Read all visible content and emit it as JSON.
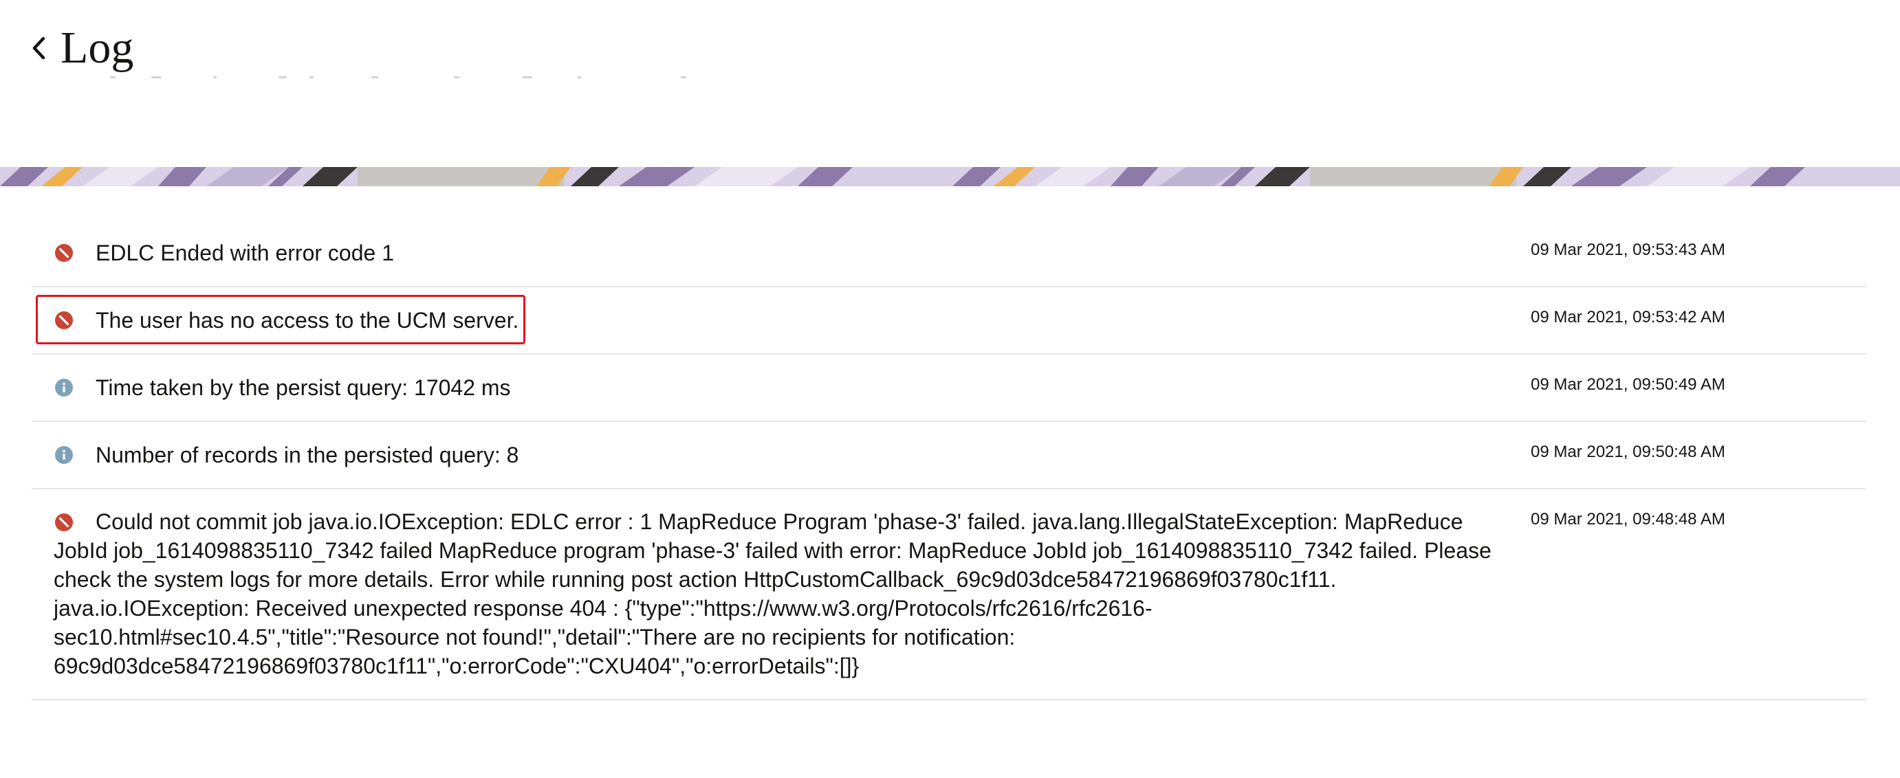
{
  "header": {
    "title": "Log",
    "back_icon": "chevron-left-icon"
  },
  "colors": {
    "error": "#c74634",
    "info": "#7ea3b8",
    "highlight": "#e0141e",
    "divider": "#e8e6e3"
  },
  "logs": [
    {
      "level": "error",
      "icon": "error-icon",
      "message": "EDLC Ended with error code 1",
      "time": "09 Mar 2021, 09:53:43 AM"
    },
    {
      "level": "error",
      "icon": "error-icon",
      "message": "The user has no access to the UCM server.",
      "time": "09 Mar 2021, 09:53:42 AM"
    },
    {
      "level": "info",
      "icon": "info-icon",
      "message": "Time taken by the persist query: 17042 ms",
      "time": "09 Mar 2021, 09:50:49 AM"
    },
    {
      "level": "info",
      "icon": "info-icon",
      "message": "Number of records in the persisted query: 8",
      "time": "09 Mar 2021, 09:50:48 AM"
    },
    {
      "level": "error",
      "icon": "error-icon",
      "message": "Could not commit job java.io.IOException: EDLC error : 1 MapReduce Program 'phase-3' failed. java.lang.IllegalStateException: MapReduce JobId job_1614098835110_7342 failed MapReduce program 'phase-3' failed with error: MapReduce JobId job_1614098835110_7342 failed. Please check the system logs for more details. Error while running post action HttpCustomCallback_69c9d03dce58472196869f03780c1f11. java.io.IOException: Received unexpected response 404 : {\"type\":\"https://www.w3.org/Protocols/rfc2616/rfc2616-sec10.html#sec10.4.5\",\"title\":\"Resource not found!\",\"detail\":\"There are no recipients for notification: 69c9d03dce58472196869f03780c1f11\",\"o:errorCode\":\"CXU404\",\"o:errorDetails\":[]}",
      "time": "09 Mar 2021, 09:48:48 AM"
    }
  ]
}
